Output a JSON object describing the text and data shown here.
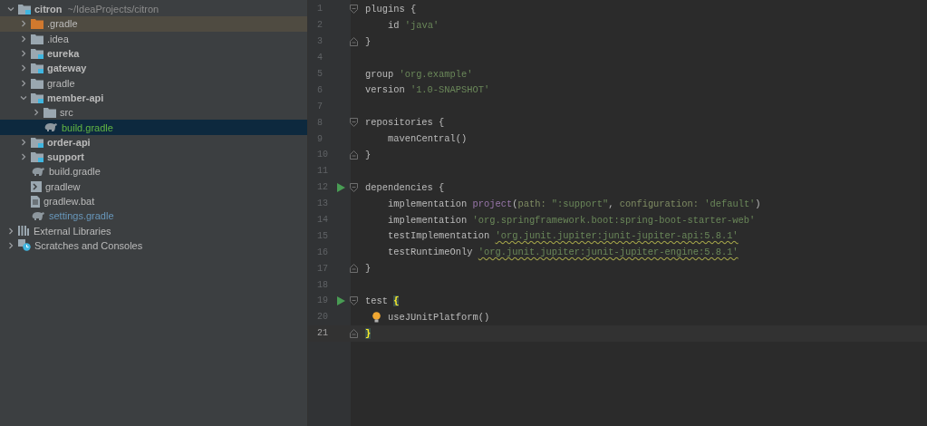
{
  "project_tree": [
    {
      "name": "citron",
      "path": "~/IdeaProjects/citron",
      "kind": "module",
      "expanded": true,
      "selected": false,
      "children": [
        {
          "name": ".gradle",
          "kind": "excluded-folder",
          "expanded": false,
          "selected": false
        },
        {
          "name": ".idea",
          "kind": "folder",
          "expanded": false,
          "selected": false
        },
        {
          "name": "eureka",
          "kind": "module",
          "expanded": false,
          "selected": false
        },
        {
          "name": "gateway",
          "kind": "module",
          "expanded": false,
          "selected": false
        },
        {
          "name": "gradle",
          "kind": "folder",
          "expanded": false,
          "selected": false
        },
        {
          "name": "member-api",
          "kind": "module",
          "expanded": true,
          "selected": false,
          "children": [
            {
              "name": "src",
              "kind": "folder",
              "expanded": false,
              "selected": false
            },
            {
              "name": "build.gradle",
              "kind": "gradle",
              "color": "#62b543",
              "selected": true
            }
          ]
        },
        {
          "name": "order-api",
          "kind": "module",
          "expanded": false,
          "selected": false
        },
        {
          "name": "support",
          "kind": "module",
          "expanded": false,
          "selected": false
        },
        {
          "name": "build.gradle",
          "kind": "gradle",
          "selected": false
        },
        {
          "name": "gradlew",
          "kind": "script",
          "selected": false
        },
        {
          "name": "gradlew.bat",
          "kind": "text",
          "selected": false
        },
        {
          "name": "settings.gradle",
          "kind": "gradle",
          "color": "#6897bb",
          "selected": false
        }
      ]
    },
    {
      "name": "External Libraries",
      "kind": "libraries",
      "expanded": false,
      "selected": false
    },
    {
      "name": "Scratches and Consoles",
      "kind": "scratches",
      "expanded": false,
      "selected": false
    }
  ],
  "editor": {
    "lines": [
      {
        "number": "1",
        "fold_start": true,
        "fold_end": false,
        "indented": false,
        "run": false,
        "hint": false,
        "current": false,
        "tokens": [
          {
            "kind": "plain",
            "text": "plugins {"
          }
        ]
      },
      {
        "number": "2",
        "fold_start": false,
        "fold_end": false,
        "indented": true,
        "run": false,
        "hint": false,
        "current": false,
        "tokens": [
          {
            "kind": "plain",
            "text": "id "
          },
          {
            "kind": "string",
            "text": "'java'"
          }
        ]
      },
      {
        "number": "3",
        "fold_start": false,
        "fold_end": true,
        "indented": false,
        "run": false,
        "hint": false,
        "current": false,
        "tokens": [
          {
            "kind": "plain",
            "text": "}"
          }
        ]
      },
      {
        "number": "4",
        "fold_start": false,
        "fold_end": false,
        "run": false,
        "hint": false,
        "current": false
      },
      {
        "number": "5",
        "fold_start": false,
        "fold_end": false,
        "indented": false,
        "run": false,
        "hint": false,
        "current": false,
        "tokens": [
          {
            "kind": "plain",
            "text": "group "
          },
          {
            "kind": "string",
            "text": "'org.example'"
          }
        ]
      },
      {
        "number": "6",
        "fold_start": false,
        "fold_end": false,
        "indented": false,
        "run": false,
        "hint": false,
        "current": false,
        "tokens": [
          {
            "kind": "plain",
            "text": "version "
          },
          {
            "kind": "string",
            "text": "'1.0-SNAPSHOT'"
          }
        ]
      },
      {
        "number": "7",
        "fold_start": false,
        "fold_end": false,
        "run": false,
        "hint": false,
        "current": false
      },
      {
        "number": "8",
        "fold_start": true,
        "fold_end": false,
        "indented": false,
        "run": false,
        "hint": false,
        "current": false,
        "tokens": [
          {
            "kind": "plain",
            "text": "repositories {"
          }
        ]
      },
      {
        "number": "9",
        "fold_start": false,
        "fold_end": false,
        "indented": true,
        "run": false,
        "hint": false,
        "current": false,
        "tokens": [
          {
            "kind": "plain",
            "text": "mavenCentral()"
          }
        ]
      },
      {
        "number": "10",
        "fold_start": false,
        "fold_end": true,
        "indented": false,
        "run": false,
        "hint": false,
        "current": false,
        "tokens": [
          {
            "kind": "plain",
            "text": "}"
          }
        ]
      },
      {
        "number": "11",
        "fold_start": false,
        "fold_end": false,
        "run": false,
        "hint": false,
        "current": false
      },
      {
        "number": "12",
        "fold_start": true,
        "fold_end": false,
        "indented": false,
        "run": true,
        "hint": false,
        "current": false,
        "tokens": [
          {
            "kind": "plain",
            "text": "dependencies {"
          }
        ]
      },
      {
        "number": "13",
        "fold_start": false,
        "fold_end": false,
        "indented": true,
        "run": false,
        "hint": false,
        "current": false,
        "tokens": [
          {
            "kind": "plain",
            "text": "implementation "
          },
          {
            "kind": "call",
            "text": "project"
          },
          {
            "kind": "plain",
            "text": "("
          },
          {
            "kind": "param",
            "text": "path: "
          },
          {
            "kind": "string",
            "text": "\":support\""
          },
          {
            "kind": "plain",
            "text": ", "
          },
          {
            "kind": "param",
            "text": "configuration: "
          },
          {
            "kind": "string",
            "text": "'default'"
          },
          {
            "kind": "plain",
            "text": ")"
          }
        ]
      },
      {
        "number": "14",
        "fold_start": false,
        "fold_end": false,
        "indented": true,
        "run": false,
        "hint": false,
        "current": false,
        "tokens": [
          {
            "kind": "plain",
            "text": "implementation "
          },
          {
            "kind": "string",
            "text": "'org.springframework.boot:spring-boot-starter-web'"
          }
        ]
      },
      {
        "number": "15",
        "fold_start": false,
        "fold_end": false,
        "indented": true,
        "run": false,
        "hint": false,
        "current": false,
        "tokens": [
          {
            "kind": "plain",
            "text": "testImplementation "
          },
          {
            "kind": "warn-string",
            "text": "'org.junit.jupiter:junit-jupiter-api:5.8.1'"
          }
        ]
      },
      {
        "number": "16",
        "fold_start": false,
        "fold_end": false,
        "indented": true,
        "run": false,
        "hint": false,
        "current": false,
        "tokens": [
          {
            "kind": "plain",
            "text": "testRuntimeOnly "
          },
          {
            "kind": "warn-string",
            "text": "'org.junit.jupiter:junit-jupiter-engine:5.8.1'"
          }
        ]
      },
      {
        "number": "17",
        "fold_start": false,
        "fold_end": true,
        "indented": false,
        "run": false,
        "hint": false,
        "current": false,
        "tokens": [
          {
            "kind": "plain",
            "text": "}"
          }
        ]
      },
      {
        "number": "18",
        "fold_start": false,
        "fold_end": false,
        "run": false,
        "hint": false,
        "current": false
      },
      {
        "number": "19",
        "fold_start": true,
        "fold_end": false,
        "indented": false,
        "run": true,
        "hint": false,
        "current": false,
        "tokens": [
          {
            "kind": "plain",
            "text": "test "
          },
          {
            "kind": "brace-match",
            "text": "{"
          }
        ]
      },
      {
        "number": "20",
        "fold_start": false,
        "fold_end": false,
        "indented": true,
        "run": false,
        "hint": true,
        "current": false,
        "tokens": [
          {
            "kind": "plain",
            "text": "useJUnitPlatform()"
          }
        ]
      },
      {
        "number": "21",
        "fold_start": false,
        "fold_end": true,
        "indented": false,
        "run": false,
        "hint": false,
        "current": true,
        "tokens": [
          {
            "kind": "brace-match",
            "text": "}"
          }
        ]
      }
    ]
  }
}
